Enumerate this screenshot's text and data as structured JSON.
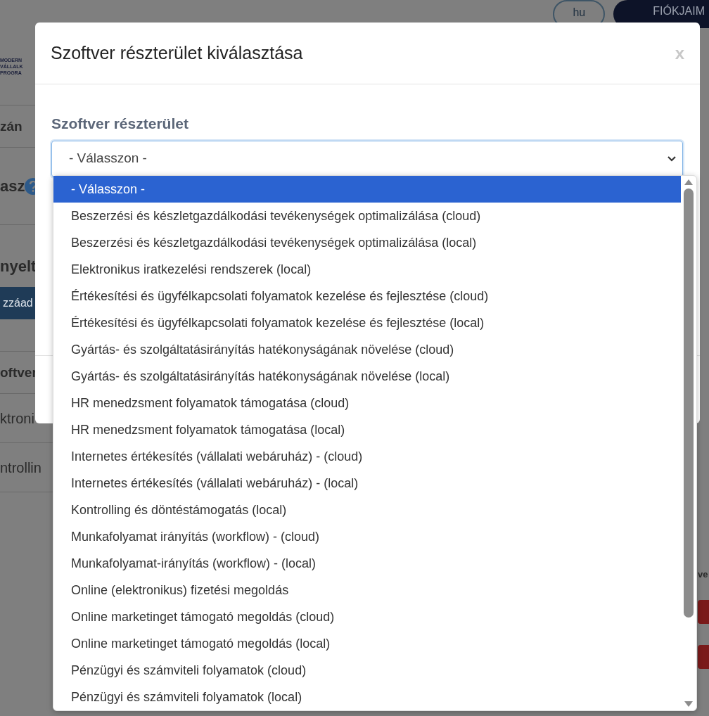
{
  "background_page": {
    "language_button": "hu",
    "account_button": "FIÓKJAIM",
    "logo_lines": [
      "MODERN",
      "VÁLLALK",
      "PROGRA"
    ],
    "left_fragments": [
      {
        "kind": "text",
        "text": "zán"
      },
      {
        "kind": "help",
        "text": "asz"
      },
      {
        "kind": "heading",
        "text": "nyelt"
      },
      {
        "kind": "button",
        "text": "zzáad"
      },
      {
        "kind": "text",
        "text": "oftver"
      },
      {
        "kind": "cell",
        "text": "ktroni"
      },
      {
        "kind": "cell",
        "text": "ntrollin"
      }
    ],
    "right_fragment": "ve"
  },
  "modal": {
    "title": "Szoftver részterület kiválasztása",
    "close": "x",
    "field_label": "Szoftver részterület",
    "select_value": "- Válasszon -",
    "options": [
      {
        "label": "- Válasszon -",
        "selected": true
      },
      {
        "label": "Beszerzési és készletgazdálkodási tevékenységek optimalizálása (cloud)",
        "selected": false
      },
      {
        "label": "Beszerzési és készletgazdálkodási tevékenységek optimalizálása (local)",
        "selected": false
      },
      {
        "label": "Elektronikus iratkezelési rendszerek (local)",
        "selected": false
      },
      {
        "label": "Értékesítési és ügyfélkapcsolati folyamatok kezelése és fejlesztése (cloud)",
        "selected": false
      },
      {
        "label": "Értékesítési és ügyfélkapcsolati folyamatok kezelése és fejlesztése (local)",
        "selected": false
      },
      {
        "label": "Gyártás- és szolgáltatásirányítás hatékonyságának növelése (cloud)",
        "selected": false
      },
      {
        "label": "Gyártás- és szolgáltatásirányítás hatékonyságának növelése (local)",
        "selected": false
      },
      {
        "label": "HR menedzsment folyamatok támogatása (cloud)",
        "selected": false
      },
      {
        "label": "HR menedzsment folyamatok támogatása (local)",
        "selected": false
      },
      {
        "label": "Internetes értékesítés (vállalati webáruház) - (cloud)",
        "selected": false
      },
      {
        "label": "Internetes értékesítés (vállalati webáruház) - (local)",
        "selected": false
      },
      {
        "label": "Kontrolling és döntéstámogatás (local)",
        "selected": false
      },
      {
        "label": "Munkafolyamat irányítás (workflow) - (cloud)",
        "selected": false
      },
      {
        "label": "Munkafolyamat-irányítás (workflow) - (local)",
        "selected": false
      },
      {
        "label": "Online (elektronikus) fizetési megoldás",
        "selected": false
      },
      {
        "label": "Online marketinget támogató megoldás (cloud)",
        "selected": false
      },
      {
        "label": "Online marketinget támogató megoldás (local)",
        "selected": false
      },
      {
        "label": "Pénzügyi és számviteli folyamatok (cloud)",
        "selected": false
      },
      {
        "label": "Pénzügyi és számviteli folyamatok (local)",
        "selected": false
      }
    ]
  }
}
